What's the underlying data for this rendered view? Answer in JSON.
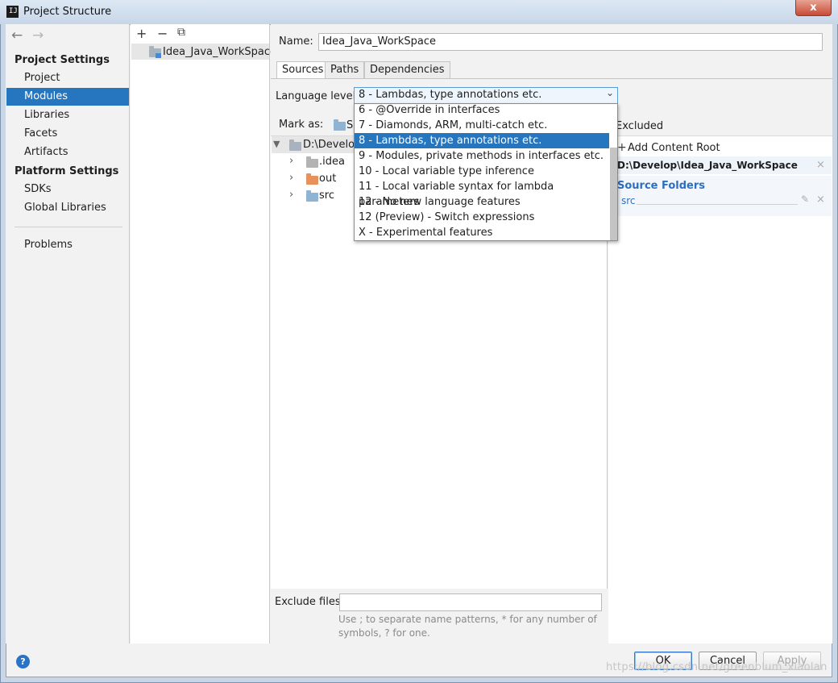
{
  "window": {
    "title": "Project Structure",
    "close_glyph": "x",
    "app_icon_glyph": "IJ"
  },
  "sidebar": {
    "back_glyph": "←",
    "forward_glyph": "→",
    "project_settings_title": "Project Settings",
    "project_items": [
      "Project",
      "Modules",
      "Libraries",
      "Facets",
      "Artifacts"
    ],
    "platform_settings_title": "Platform Settings",
    "platform_items": [
      "SDKs",
      "Global Libraries"
    ],
    "problems": "Problems"
  },
  "modules_toolbar": {
    "add": "+",
    "remove": "−",
    "copy": "⧉"
  },
  "module": {
    "name": "Idea_Java_WorkSpace"
  },
  "name_field": {
    "label": "Name:",
    "value": "Idea_Java_WorkSpace"
  },
  "tabs": [
    "Sources",
    "Paths",
    "Dependencies"
  ],
  "language_level": {
    "label": "Language level:",
    "selected": "8 - Lambdas, type annotations etc.",
    "options": [
      "6 - @Override in interfaces",
      "7 - Diamonds, ARM, multi-catch etc.",
      "8 - Lambdas, type annotations etc.",
      "9 - Modules, private methods in interfaces etc.",
      "10 - Local variable type inference",
      "11 - Local variable syntax for lambda parameters",
      "12 - No new language features",
      "12 (Preview) - Switch expressions",
      "X - Experimental features"
    ]
  },
  "mark_as": {
    "label": "Mark as:",
    "visible_fragment": "S",
    "excluded": "Excluded"
  },
  "tree": {
    "root": "D:\\Develop",
    "children": [
      ".idea",
      "out",
      "src"
    ]
  },
  "right_panel": {
    "add_content_root": "Add Content Root",
    "content_root": "D:\\Develop\\Idea_Java_WorkSpace",
    "source_folders_title": "Source Folders",
    "source_folder": "src",
    "remove_glyph": "×",
    "edit_glyph": "✎",
    "plus_glyph": "+"
  },
  "exclude_files": {
    "label": "Exclude files:",
    "value": "",
    "hint_line1": "Use ; to separate name patterns, * for any number of",
    "hint_line2": "symbols, ? for one."
  },
  "buttons": {
    "ok": "OK",
    "cancel": "Cancel",
    "apply": "Apply",
    "help": "?"
  },
  "watermark": "https://blog.csdn.net/greenblum_xiaolan",
  "colors": {
    "selection": "#2675bf",
    "source_folder": "#2d6fbf",
    "excluded_folder": "#e7925c",
    "folder": "#8fb3d3"
  }
}
